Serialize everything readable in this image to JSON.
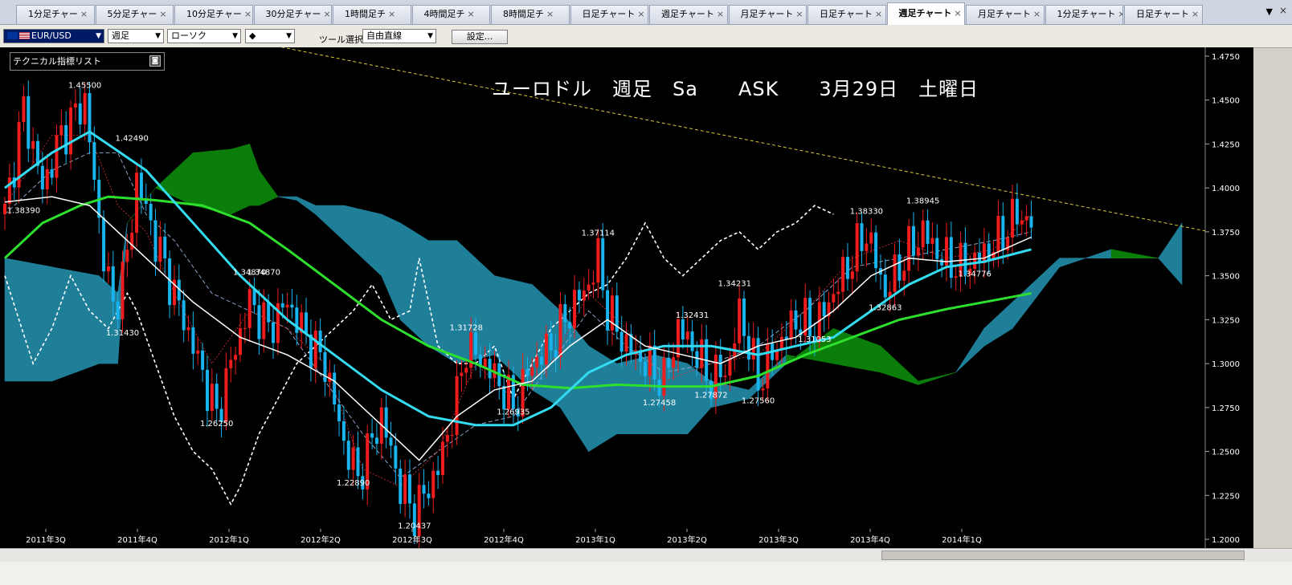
{
  "tabs": [
    {
      "label": "1分足チャー",
      "active": false
    },
    {
      "label": "5分足チャー",
      "active": false
    },
    {
      "label": "10分足チャー",
      "active": false
    },
    {
      "label": "30分足チャー",
      "active": false
    },
    {
      "label": "1時間足チ",
      "active": false
    },
    {
      "label": "4時間足チ",
      "active": false
    },
    {
      "label": "8時間足チ",
      "active": false
    },
    {
      "label": "日足チャート",
      "active": false
    },
    {
      "label": "週足チャート",
      "active": false
    },
    {
      "label": "月足チャート",
      "active": false
    },
    {
      "label": "日足チャート",
      "active": false
    },
    {
      "label": "週足チャート",
      "active": true
    },
    {
      "label": "月足チャート",
      "active": false
    },
    {
      "label": "1分足チャート",
      "active": false
    },
    {
      "label": "日足チャート",
      "active": false
    }
  ],
  "tab_close_glyph": "×",
  "tab_menu_glyph": "▼",
  "window_close_glyph": "×",
  "toolbar": {
    "symbol": "EUR/USD",
    "timeframe": "週足",
    "chart_type": "ローソク",
    "marker": "◆",
    "tool_label": "ツール選択",
    "tool": "自由直線",
    "settings": "設定..."
  },
  "indicator_panel": {
    "label": "テクニカル指標リスト"
  },
  "overlay_title": "ユーロドル　週足　Sa　　ASK　　3月29日　土曜日",
  "colors": {
    "up": "#ee1c1c",
    "down": "#19b3ee",
    "ma_white": "#ffffff",
    "ma_cyan": "#33dcf0",
    "ma_green": "#2ee02e",
    "cloud_up": "#0a7d0a",
    "cloud_down": "#1f7f99",
    "trend": "#d9c83a"
  },
  "chart_data": {
    "type": "candlestick",
    "instrument": "EUR/USD",
    "timeframe": "週足",
    "price_range": [
      1.195,
      1.48
    ],
    "y_ticks": [
      "1.4750",
      "1.4500",
      "1.4250",
      "1.4000",
      "1.3750",
      "1.3500",
      "1.3250",
      "1.3000",
      "1.2750",
      "1.2500",
      "1.2250",
      "1.2000"
    ],
    "x_ticks": [
      "2011年3Q",
      "2011年4Q",
      "2012年1Q",
      "2012年2Q",
      "2012年3Q",
      "2012年4Q",
      "2013年1Q",
      "2013年2Q",
      "2013年3Q",
      "2013年4Q",
      "2014年1Q"
    ],
    "annotations": [
      {
        "text": "1.45500",
        "bar": 17,
        "price": 1.455
      },
      {
        "text": "1.42490",
        "bar": 27,
        "price": 1.4249
      },
      {
        "text": "1.38390",
        "bar": 4,
        "price": 1.3839
      },
      {
        "text": "1.31430",
        "bar": 25,
        "price": 1.3143
      },
      {
        "text": "1.34870",
        "bar": 52,
        "price": 1.3487
      },
      {
        "text": "1.34870",
        "bar": 55,
        "price": 1.3487
      },
      {
        "text": "1.26250",
        "bar": 45,
        "price": 1.2625
      },
      {
        "text": "1.22890",
        "bar": 74,
        "price": 1.2289
      },
      {
        "text": "1.20437",
        "bar": 87,
        "price": 1.2043
      },
      {
        "text": "1.31728",
        "bar": 98,
        "price": 1.3172
      },
      {
        "text": "1.26935",
        "bar": 108,
        "price": 1.2693
      },
      {
        "text": "1.37114",
        "bar": 126,
        "price": 1.3711
      },
      {
        "text": "1.32431",
        "bar": 146,
        "price": 1.3243
      },
      {
        "text": "1.27458",
        "bar": 139,
        "price": 1.2745
      },
      {
        "text": "1.27872",
        "bar": 150,
        "price": 1.2787
      },
      {
        "text": "1.34231",
        "bar": 155,
        "price": 1.3423
      },
      {
        "text": "1.27560",
        "bar": 160,
        "price": 1.2756
      },
      {
        "text": "1.31053",
        "bar": 172,
        "price": 1.3105
      },
      {
        "text": "1.38330",
        "bar": 183,
        "price": 1.3833
      },
      {
        "text": "1.32863",
        "bar": 187,
        "price": 1.3286
      },
      {
        "text": "1.38945",
        "bar": 195,
        "price": 1.3894
      },
      {
        "text": "1.34776",
        "bar": 206,
        "price": 1.3477
      }
    ],
    "bars": {
      "count": 219,
      "keyframes": [
        [
          0,
          1.385
        ],
        [
          4,
          1.445
        ],
        [
          8,
          1.4
        ],
        [
          12,
          1.43
        ],
        [
          17,
          1.45
        ],
        [
          20,
          1.38
        ],
        [
          23,
          1.33
        ],
        [
          26,
          1.36
        ],
        [
          28,
          1.405
        ],
        [
          32,
          1.37
        ],
        [
          36,
          1.34
        ],
        [
          40,
          1.31
        ],
        [
          45,
          1.27
        ],
        [
          48,
          1.3
        ],
        [
          52,
          1.335
        ],
        [
          56,
          1.32
        ],
        [
          60,
          1.335
        ],
        [
          64,
          1.315
        ],
        [
          68,
          1.3
        ],
        [
          72,
          1.255
        ],
        [
          75,
          1.235
        ],
        [
          80,
          1.27
        ],
        [
          84,
          1.23
        ],
        [
          87,
          1.215
        ],
        [
          92,
          1.24
        ],
        [
          96,
          1.28
        ],
        [
          98,
          1.31
        ],
        [
          102,
          1.3
        ],
        [
          106,
          1.285
        ],
        [
          108,
          1.275
        ],
        [
          112,
          1.3
        ],
        [
          116,
          1.31
        ],
        [
          120,
          1.33
        ],
        [
          124,
          1.345
        ],
        [
          126,
          1.36
        ],
        [
          128,
          1.33
        ],
        [
          132,
          1.31
        ],
        [
          136,
          1.3
        ],
        [
          140,
          1.29
        ],
        [
          143,
          1.32
        ],
        [
          146,
          1.31
        ],
        [
          150,
          1.29
        ],
        [
          154,
          1.3
        ],
        [
          156,
          1.33
        ],
        [
          160,
          1.29
        ],
        [
          164,
          1.31
        ],
        [
          168,
          1.325
        ],
        [
          172,
          1.32
        ],
        [
          176,
          1.34
        ],
        [
          180,
          1.36
        ],
        [
          183,
          1.375
        ],
        [
          187,
          1.34
        ],
        [
          191,
          1.36
        ],
        [
          195,
          1.375
        ],
        [
          199,
          1.36
        ],
        [
          203,
          1.355
        ],
        [
          207,
          1.36
        ],
        [
          211,
          1.37
        ],
        [
          215,
          1.385
        ],
        [
          218,
          1.38
        ]
      ]
    },
    "ma_white": [
      [
        0,
        1.392
      ],
      [
        10,
        1.395
      ],
      [
        18,
        1.39
      ],
      [
        30,
        1.36
      ],
      [
        40,
        1.335
      ],
      [
        50,
        1.315
      ],
      [
        60,
        1.305
      ],
      [
        70,
        1.29
      ],
      [
        80,
        1.265
      ],
      [
        88,
        1.245
      ],
      [
        96,
        1.27
      ],
      [
        104,
        1.285
      ],
      [
        112,
        1.29
      ],
      [
        120,
        1.31
      ],
      [
        128,
        1.325
      ],
      [
        136,
        1.31
      ],
      [
        144,
        1.305
      ],
      [
        152,
        1.3
      ],
      [
        160,
        1.31
      ],
      [
        168,
        1.315
      ],
      [
        176,
        1.33
      ],
      [
        184,
        1.35
      ],
      [
        192,
        1.36
      ],
      [
        200,
        1.358
      ],
      [
        208,
        1.36
      ],
      [
        218,
        1.372
      ]
    ],
    "ma_cyan": [
      [
        0,
        1.4
      ],
      [
        10,
        1.42
      ],
      [
        18,
        1.432
      ],
      [
        30,
        1.41
      ],
      [
        40,
        1.38
      ],
      [
        50,
        1.35
      ],
      [
        60,
        1.325
      ],
      [
        70,
        1.305
      ],
      [
        80,
        1.285
      ],
      [
        90,
        1.27
      ],
      [
        100,
        1.265
      ],
      [
        108,
        1.265
      ],
      [
        116,
        1.275
      ],
      [
        124,
        1.295
      ],
      [
        132,
        1.305
      ],
      [
        140,
        1.31
      ],
      [
        150,
        1.31
      ],
      [
        160,
        1.305
      ],
      [
        168,
        1.31
      ],
      [
        176,
        1.315
      ],
      [
        184,
        1.33
      ],
      [
        192,
        1.345
      ],
      [
        200,
        1.355
      ],
      [
        208,
        1.358
      ],
      [
        218,
        1.365
      ]
    ],
    "ma_green": [
      [
        0,
        1.36
      ],
      [
        8,
        1.38
      ],
      [
        16,
        1.39
      ],
      [
        22,
        1.395
      ],
      [
        32,
        1.393
      ],
      [
        42,
        1.39
      ],
      [
        52,
        1.38
      ],
      [
        60,
        1.365
      ],
      [
        70,
        1.345
      ],
      [
        80,
        1.325
      ],
      [
        90,
        1.31
      ],
      [
        100,
        1.3
      ],
      [
        110,
        1.288
      ],
      [
        120,
        1.286
      ],
      [
        130,
        1.288
      ],
      [
        140,
        1.287
      ],
      [
        150,
        1.287
      ],
      [
        160,
        1.293
      ],
      [
        170,
        1.305
      ],
      [
        180,
        1.315
      ],
      [
        190,
        1.325
      ],
      [
        200,
        1.331
      ],
      [
        210,
        1.336
      ],
      [
        218,
        1.34
      ]
    ],
    "cloud_a": [
      [
        0,
        1.29
      ],
      [
        10,
        1.29
      ],
      [
        20,
        1.3
      ],
      [
        24,
        1.3
      ],
      [
        26,
        1.38
      ],
      [
        32,
        1.4
      ],
      [
        40,
        1.42
      ],
      [
        48,
        1.422
      ],
      [
        52,
        1.425
      ],
      [
        54,
        1.41
      ],
      [
        58,
        1.395
      ],
      [
        62,
        1.393
      ],
      [
        66,
        1.385
      ],
      [
        72,
        1.37
      ],
      [
        80,
        1.35
      ],
      [
        84,
        1.325
      ],
      [
        90,
        1.31
      ],
      [
        96,
        1.3
      ],
      [
        104,
        1.305
      ],
      [
        112,
        1.285
      ],
      [
        118,
        1.275
      ],
      [
        124,
        1.25
      ],
      [
        130,
        1.26
      ],
      [
        138,
        1.26
      ],
      [
        145,
        1.26
      ],
      [
        150,
        1.275
      ],
      [
        158,
        1.28
      ],
      [
        166,
        1.3
      ],
      [
        176,
        1.32
      ],
      [
        186,
        1.31
      ],
      [
        194,
        1.29
      ],
      [
        202,
        1.295
      ],
      [
        208,
        1.31
      ],
      [
        214,
        1.32
      ],
      [
        224,
        1.355
      ],
      [
        235,
        1.365
      ],
      [
        245,
        1.36
      ],
      [
        250,
        1.345
      ]
    ],
    "cloud_b": [
      [
        0,
        1.36
      ],
      [
        10,
        1.355
      ],
      [
        20,
        1.35
      ],
      [
        24,
        1.34
      ],
      [
        26,
        1.38
      ],
      [
        32,
        1.4
      ],
      [
        40,
        1.39
      ],
      [
        48,
        1.385
      ],
      [
        52,
        1.39
      ],
      [
        54,
        1.39
      ],
      [
        58,
        1.395
      ],
      [
        62,
        1.395
      ],
      [
        66,
        1.39
      ],
      [
        72,
        1.39
      ],
      [
        80,
        1.385
      ],
      [
        84,
        1.38
      ],
      [
        90,
        1.37
      ],
      [
        96,
        1.37
      ],
      [
        104,
        1.35
      ],
      [
        112,
        1.345
      ],
      [
        118,
        1.33
      ],
      [
        124,
        1.31
      ],
      [
        130,
        1.3
      ],
      [
        138,
        1.305
      ],
      [
        145,
        1.3
      ],
      [
        150,
        1.29
      ],
      [
        158,
        1.285
      ],
      [
        166,
        1.305
      ],
      [
        176,
        1.3
      ],
      [
        186,
        1.295
      ],
      [
        194,
        1.288
      ],
      [
        202,
        1.295
      ],
      [
        208,
        1.32
      ],
      [
        214,
        1.335
      ],
      [
        224,
        1.36
      ],
      [
        235,
        1.36
      ],
      [
        245,
        1.36
      ],
      [
        250,
        1.38
      ]
    ],
    "chikou": [
      [
        0,
        1.35
      ],
      [
        6,
        1.3
      ],
      [
        10,
        1.32
      ],
      [
        14,
        1.35
      ],
      [
        18,
        1.33
      ],
      [
        22,
        1.32
      ],
      [
        26,
        1.34
      ],
      [
        28,
        1.33
      ],
      [
        32,
        1.3
      ],
      [
        36,
        1.27
      ],
      [
        40,
        1.25
      ],
      [
        44,
        1.24
      ],
      [
        48,
        1.22
      ],
      [
        50,
        1.23
      ],
      [
        54,
        1.26
      ],
      [
        58,
        1.28
      ],
      [
        62,
        1.3
      ],
      [
        66,
        1.31
      ],
      [
        70,
        1.32
      ],
      [
        74,
        1.33
      ],
      [
        78,
        1.345
      ],
      [
        82,
        1.325
      ],
      [
        86,
        1.33
      ],
      [
        88,
        1.36
      ],
      [
        92,
        1.31
      ],
      [
        96,
        1.3
      ],
      [
        100,
        1.3
      ],
      [
        104,
        1.31
      ],
      [
        108,
        1.28
      ],
      [
        112,
        1.3
      ],
      [
        116,
        1.32
      ],
      [
        120,
        1.33
      ],
      [
        124,
        1.34
      ],
      [
        128,
        1.345
      ],
      [
        132,
        1.36
      ],
      [
        136,
        1.38
      ],
      [
        140,
        1.36
      ],
      [
        144,
        1.35
      ],
      [
        148,
        1.36
      ],
      [
        152,
        1.37
      ],
      [
        156,
        1.375
      ],
      [
        160,
        1.365
      ],
      [
        164,
        1.375
      ],
      [
        168,
        1.38
      ],
      [
        172,
        1.39
      ],
      [
        176,
        1.385
      ]
    ],
    "kijun": [
      [
        0,
        1.385
      ],
      [
        10,
        1.41
      ],
      [
        18,
        1.42
      ],
      [
        24,
        1.42
      ],
      [
        30,
        1.385
      ],
      [
        36,
        1.37
      ],
      [
        44,
        1.34
      ],
      [
        52,
        1.33
      ],
      [
        60,
        1.32
      ],
      [
        68,
        1.29
      ],
      [
        76,
        1.26
      ],
      [
        84,
        1.235
      ],
      [
        92,
        1.25
      ],
      [
        100,
        1.265
      ],
      [
        108,
        1.27
      ],
      [
        116,
        1.3
      ],
      [
        124,
        1.33
      ],
      [
        132,
        1.31
      ],
      [
        140,
        1.295
      ],
      [
        150,
        1.3
      ],
      [
        160,
        1.31
      ],
      [
        170,
        1.33
      ],
      [
        180,
        1.355
      ],
      [
        190,
        1.36
      ],
      [
        200,
        1.365
      ],
      [
        210,
        1.37
      ],
      [
        218,
        1.375
      ]
    ],
    "tenkan": [
      [
        0,
        1.39
      ],
      [
        10,
        1.43
      ],
      [
        18,
        1.43
      ],
      [
        24,
        1.39
      ],
      [
        30,
        1.375
      ],
      [
        36,
        1.34
      ],
      [
        44,
        1.3
      ],
      [
        52,
        1.33
      ],
      [
        60,
        1.32
      ],
      [
        68,
        1.3
      ],
      [
        76,
        1.24
      ],
      [
        84,
        1.23
      ],
      [
        92,
        1.25
      ],
      [
        100,
        1.3
      ],
      [
        108,
        1.28
      ],
      [
        116,
        1.3
      ],
      [
        124,
        1.34
      ],
      [
        132,
        1.32
      ],
      [
        140,
        1.29
      ],
      [
        150,
        1.3
      ],
      [
        160,
        1.305
      ],
      [
        170,
        1.33
      ],
      [
        180,
        1.36
      ],
      [
        190,
        1.37
      ],
      [
        200,
        1.36
      ],
      [
        210,
        1.365
      ],
      [
        218,
        1.385
      ]
    ],
    "trendline": [
      [
        1.512
      ],
      [
        1.3755
      ]
    ]
  }
}
